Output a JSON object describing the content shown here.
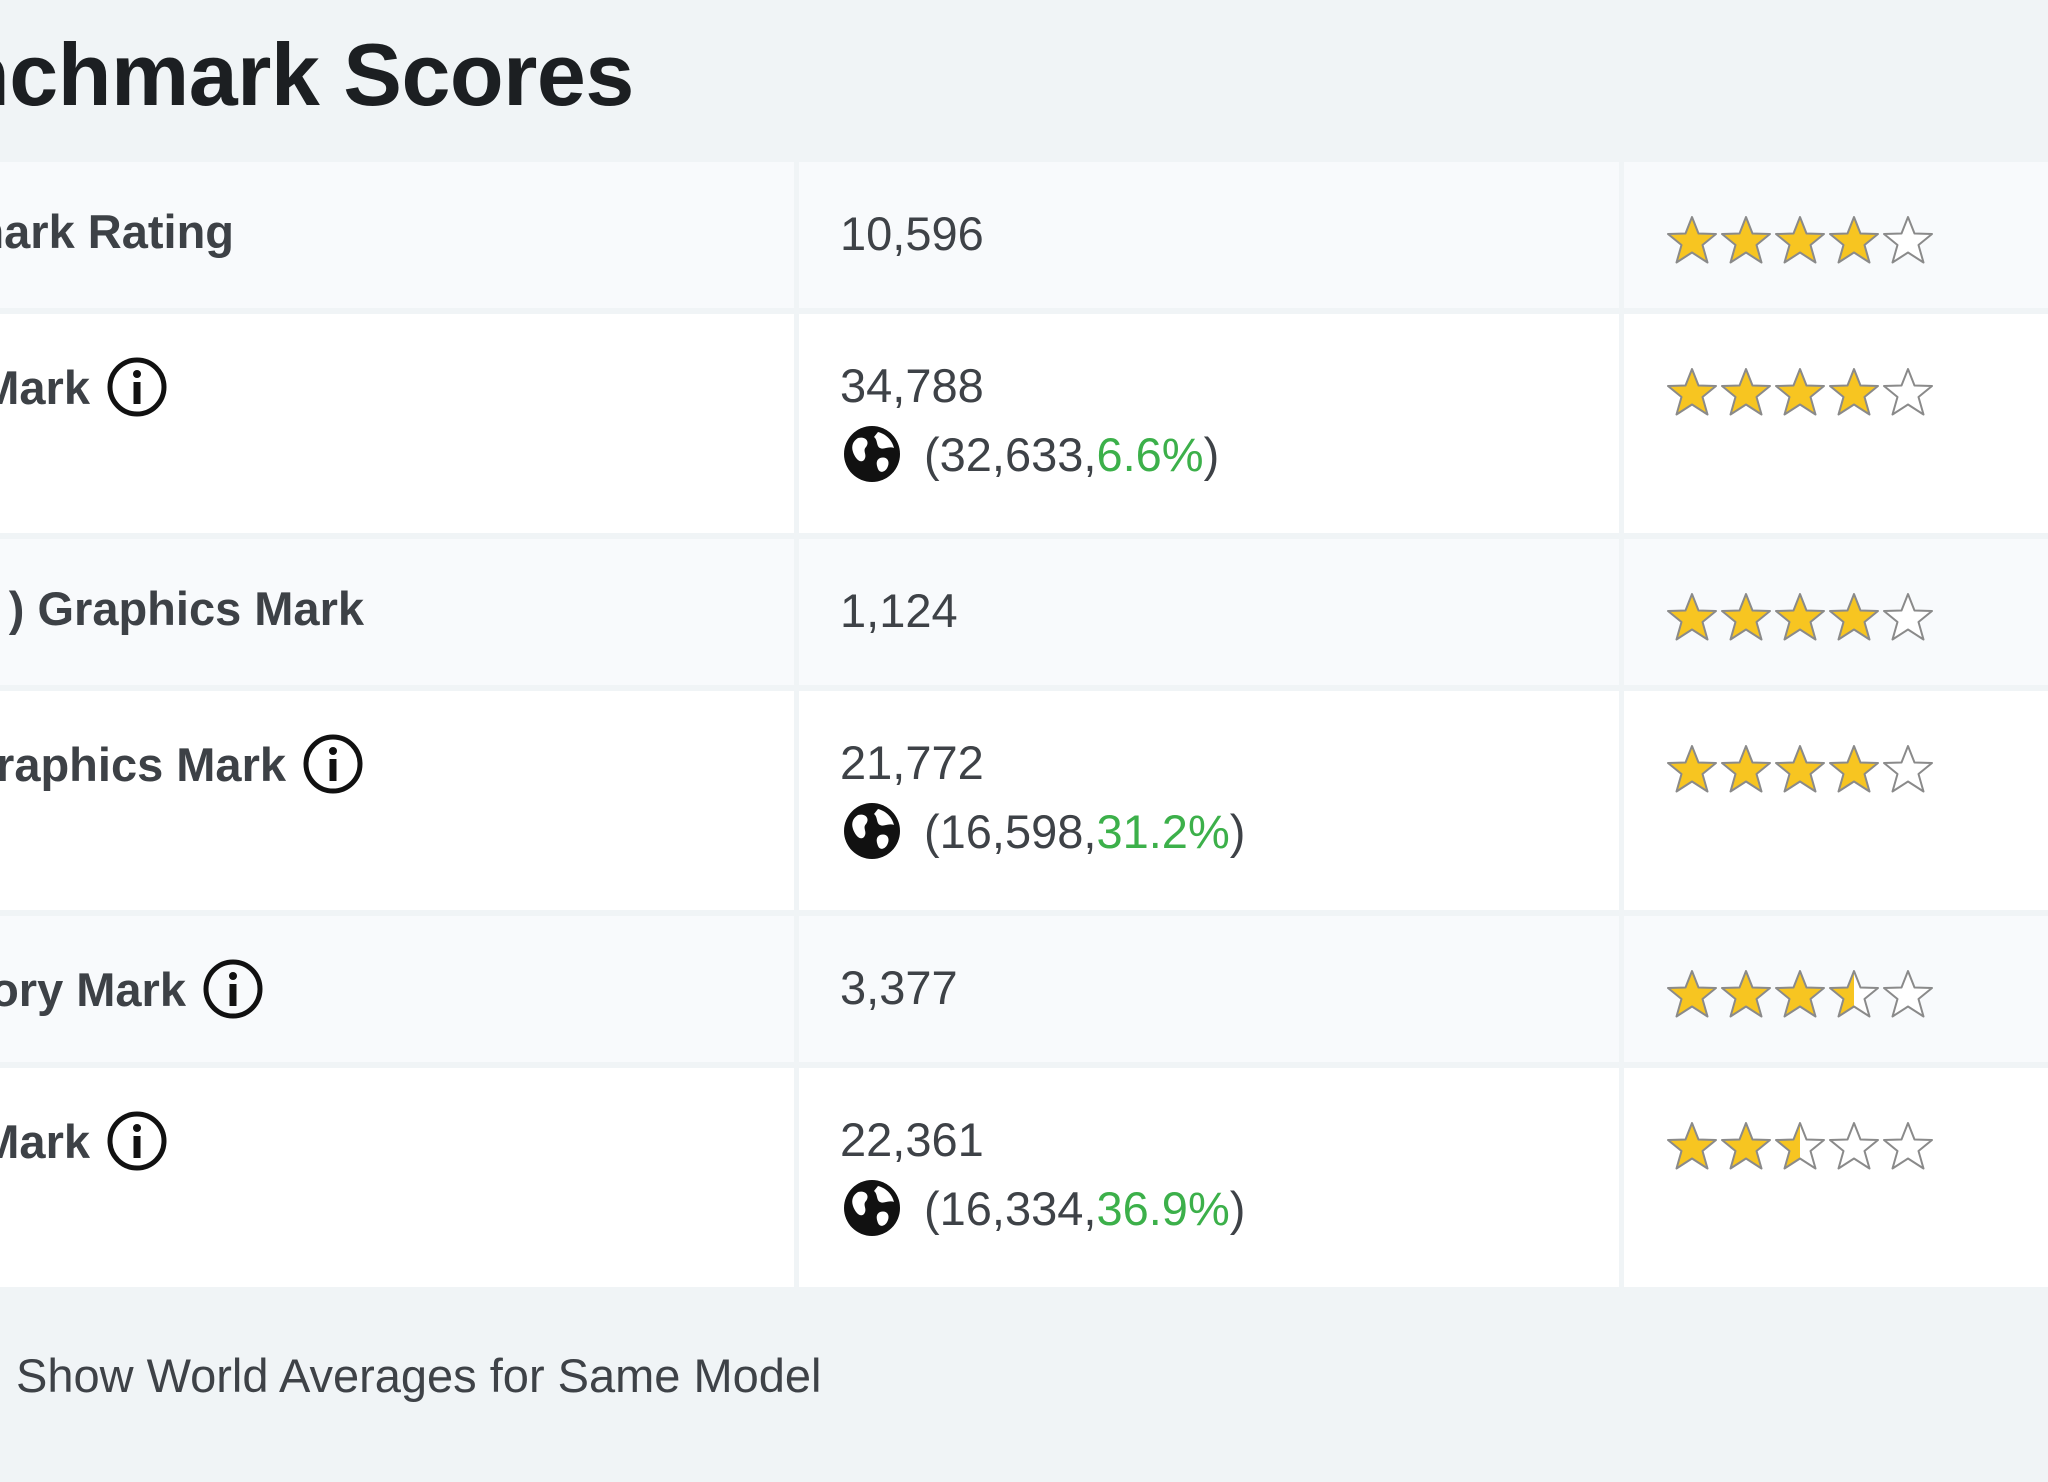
{
  "section": {
    "title": "nchmark Scores"
  },
  "colors": {
    "star_fill": "#f7c521",
    "star_empty": "#ffffff",
    "star_stroke": "#8a8a8a",
    "percent": "#3cb04a"
  },
  "rows": [
    {
      "label": "smark Rating",
      "score": "10,596",
      "has_info": false,
      "stars": 4
    },
    {
      "label": "PU Mark",
      "score": "34,788",
      "has_info": true,
      "avg_open": "(32,633, ",
      "avg_pct": "6.6%",
      "avg_close": ")",
      "stars": 4
    },
    {
      "label": ") Graphics Mark",
      "score": "1,124",
      "has_info": false,
      "stars": 4
    },
    {
      "label": ") Graphics Mark",
      "score": "21,772",
      "has_info": true,
      "avg_open": "(16,598, ",
      "avg_pct": "31.2%",
      "avg_close": ")",
      "stars": 4
    },
    {
      "label": "emory Mark",
      "score": "3,377",
      "has_info": true,
      "stars": 3.5
    },
    {
      "label": "sk Mark",
      "score": "22,361",
      "has_info": true,
      "avg_open": "(16,334, ",
      "avg_pct": "36.9%",
      "avg_close": ")",
      "stars": 2.5
    }
  ],
  "footer": {
    "link_text": "Show World Averages for Same Model"
  }
}
